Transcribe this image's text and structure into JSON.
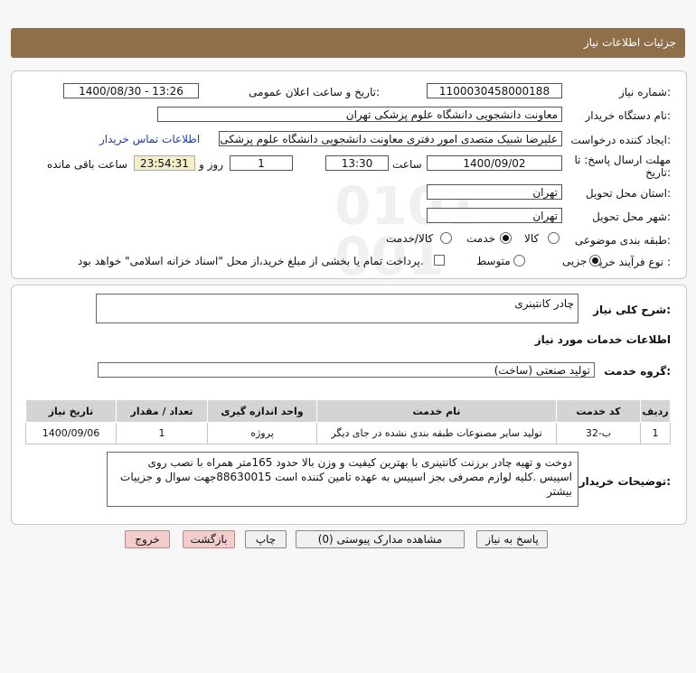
{
  "header": {
    "title": "جزئیات اطلاعات نیاز"
  },
  "form": {
    "need_number_label": "شماره نیاز:",
    "need_number": "1100030458000188",
    "announce_label": "تاریخ و ساعت اعلان عمومی:",
    "announce_value": "1400/08/30 - 13:26",
    "buyer_org_label": "نام دستگاه خریدار:",
    "buyer_org": "معاونت دانشجویی دانشگاه علوم پزشکی تهران",
    "requester_label": "ایجاد کننده درخواست:",
    "requester": "علیرضا شبیک متصدی امور دفتری معاونت دانشجویی دانشگاه علوم پزشکی تهران",
    "contact_link": "اطلاعات تماس خریدار",
    "deadline_label_1": "مهلت ارسال پاسخ: تا",
    "deadline_label_2": "تاریخ:",
    "deadline_date": "1400/09/02",
    "time_label": "ساعت",
    "deadline_time": "13:30",
    "days_value": "1",
    "days_label": "روز و",
    "remaining_time": "23:54:31",
    "remaining_label": "ساعت باقی مانده",
    "province_label": "استان محل تحویل:",
    "province": "تهران",
    "city_label": "شهر محل تحویل:",
    "city": "تهران",
    "category_label": "طبقه بندی موضوعی:",
    "category_options": [
      "کالا",
      "خدمت",
      "کالا/خدمت"
    ],
    "purchase_type_label": "نوع فرآیند خرید :",
    "purchase_options": [
      "جزیی",
      "متوسط"
    ],
    "payment_note": "پرداخت تمام یا بخشی از مبلغ خرید،از محل \"اسناد خزانه اسلامی\" خواهد بود."
  },
  "details": {
    "summary_label": "شرح کلی نیاز:",
    "summary": "چادر کانتینری",
    "services_heading": "اطلاعات خدمات مورد نیاز",
    "service_group_label": "گروه خدمت:",
    "service_group": "تولید صنعتی (ساخت)",
    "table": {
      "headers": [
        "ردیف",
        "کد خدمت",
        "نام خدمت",
        "واحد اندازه گیری",
        "تعداد / مقدار",
        "تاریخ نیاز"
      ],
      "rows": [
        [
          "1",
          "ب-32",
          "تولید سایر مصنوعات طبقه بندی نشده در جای دیگر",
          "پروژه",
          "1",
          "1400/09/06"
        ]
      ]
    },
    "buyer_notes_label": "توضیحات خریدار:",
    "buyer_notes": "دوخت و تهیه چادر برزنت کانتینری با بهترین کیفیت و وزن بالا حدود 165متر همراه با نصب روی اسپیس .کلیه لوازم مصرفی بجز اسپیس به عهده تامین کننده است 88630015جهت سوال و جزییات بیشتر"
  },
  "buttons": {
    "reply": "پاسخ به نیاز",
    "documents": "مشاهده مدارک پیوستی (0)",
    "print": "چاپ",
    "back": "بازگشت",
    "exit": "خروج"
  }
}
